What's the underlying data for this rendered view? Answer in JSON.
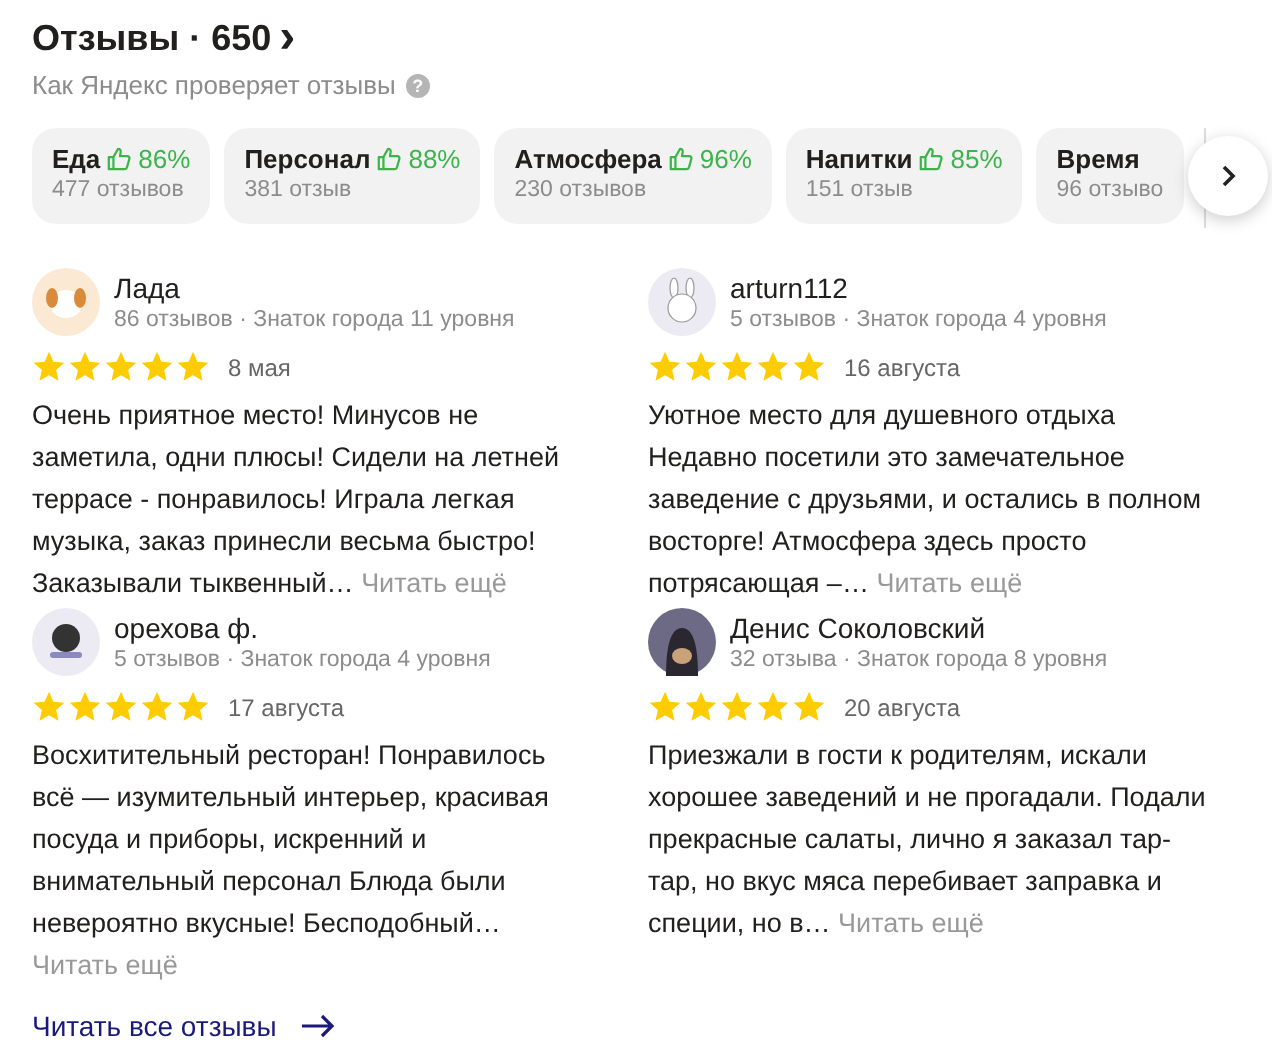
{
  "header": {
    "title": "Отзывы · 650",
    "chevron": "›",
    "subtitle": "Как Яндекс проверяет отзывы",
    "help": "?"
  },
  "categories": [
    {
      "label": "Еда",
      "percent": "86%",
      "count": "477 отзывов"
    },
    {
      "label": "Персонал",
      "percent": "88%",
      "count": "381 отзыв"
    },
    {
      "label": "Атмосфера",
      "percent": "96%",
      "count": "230 отзывов"
    },
    {
      "label": "Напитки",
      "percent": "85%",
      "count": "151 отзыв"
    },
    {
      "label": "Время",
      "count": "96 отзыво"
    }
  ],
  "reviews": [
    {
      "author": "Лада",
      "meta": "86 отзывов · Знаток города 11 уровня",
      "stars": 5,
      "date": "8 мая",
      "text": "Очень приятное место! Минусов не\nзаметила, одни плюсы! Сидели на летней\nтеррасе - понравилось! Играла легкая\nмузыка, заказ принесли весьма быстро!\nЗаказывали тыквенный…",
      "more": "Читать ещё"
    },
    {
      "author": "arturn112",
      "meta": "5 отзывов · Знаток города 4 уровня",
      "stars": 5,
      "date": "16 августа",
      "text": "Уютное место для душевного отдыха\nНедавно посетили это замечательное\nзаведение с друзьями, и остались в полном\nвосторге! Атмосфера здесь просто\nпотрясающая –…",
      "more": "Читать ещё"
    },
    {
      "author": "орехова ф.",
      "meta": "5 отзывов · Знаток города 4 уровня",
      "stars": 5,
      "date": "17 августа",
      "text": "Восхитительный ресторан! Понравилось\nвсё — изумительный интерьер, красивая\nпосуда и приборы, искренний и\nвнимательный персонал Блюда были\nневероятно вкусные! Бесподобный…",
      "more": "Читать ещё"
    },
    {
      "author": "Денис Соколовский",
      "meta": "32 отзыва · Знаток города 8 уровня",
      "stars": 5,
      "date": "20 августа",
      "text": "Приезжали в гости к родителям, искали\nхорошее заведений и не прогадали. Подали\nпрекрасные салаты, лично я заказал тар-\nтар, но вкус мяса перебивает заправка и\nспеции, но в…",
      "more": "Читать ещё"
    }
  ],
  "all_reviews_link": "Читать все отзывы"
}
